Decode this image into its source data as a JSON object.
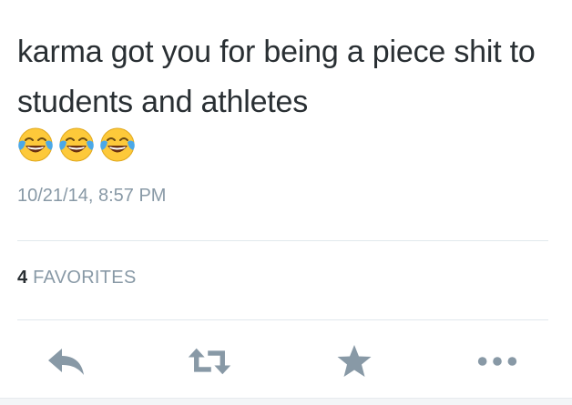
{
  "tweet": {
    "text": "karma got you for being a piece shit to students and athletes",
    "emojis": [
      "face-with-tears-of-joy",
      "face-with-tears-of-joy",
      "face-with-tears-of-joy"
    ],
    "timestamp": "10/21/14, 8:57 PM"
  },
  "stats": {
    "favorites_count": "4",
    "favorites_label": "FAVORITES"
  },
  "actions": [
    {
      "name": "reply",
      "icon": "reply-icon"
    },
    {
      "name": "retweet",
      "icon": "retweet-icon"
    },
    {
      "name": "favorite",
      "icon": "star-icon"
    },
    {
      "name": "more",
      "icon": "more-icon"
    }
  ],
  "colors": {
    "text": "#292f33",
    "secondary": "#8899a6",
    "icon": "#8899a6",
    "divider": "#e1e8ed",
    "emoji_face": "#fdc93a",
    "emoji_tear": "#4aa8e8"
  }
}
